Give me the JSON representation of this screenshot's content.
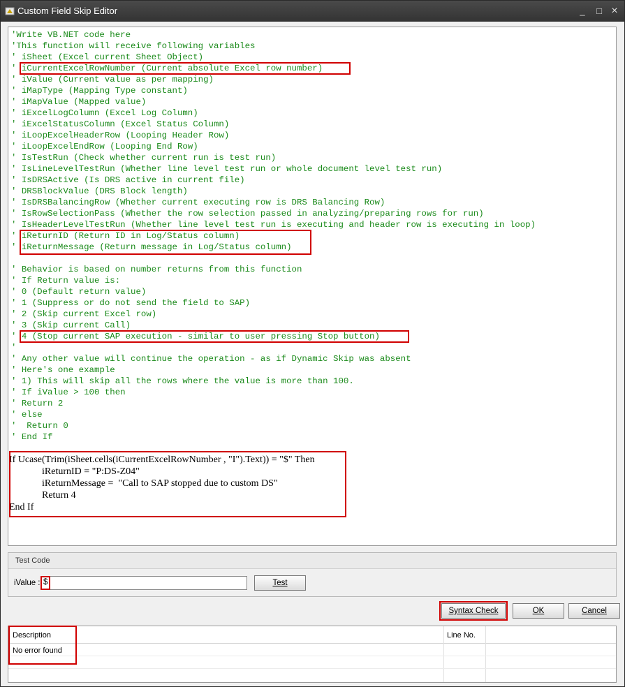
{
  "window": {
    "title": "Custom Field Skip Editor",
    "minimize_glyph": "_",
    "restore_glyph": "□",
    "close_glyph": "×"
  },
  "editor": {
    "comment_lines": [
      "'Write VB.NET code here",
      "'This function will receive following variables",
      "' iSheet (Excel current Sheet Object)",
      "' iCurrentExcelRowNumber (Current absolute Excel row number)",
      "' iValue (Current value as per mapping)",
      "' iMapType (Mapping Type constant)",
      "' iMapValue (Mapped value)",
      "' iExcelLogColumn (Excel Log Column)",
      "' iExcelStatusColumn (Excel Status Column)",
      "' iLoopExcelHeaderRow (Looping Header Row)",
      "' iLoopExcelEndRow (Looping End Row)",
      "' IsTestRun (Check whether current run is test run)",
      "' IsLineLevelTestRun (Whether line level test run or whole document level test run)",
      "' IsDRSActive (Is DRS active in current file)",
      "' DRSBlockValue (DRS Block length)",
      "' IsDRSBalancingRow (Whether current executing row is DRS Balancing Row)",
      "' IsRowSelectionPass (Whether the row selection passed in analyzing/preparing rows for run)",
      "' IsHeaderLevelTestRun (Whether line level test run is executing and header row is executing in loop)",
      "' iReturnID (Return ID in Log/Status column)",
      "' iReturnMessage (Return message in Log/Status column)",
      "",
      "' Behavior is based on number returns from this function",
      "' If Return value is:",
      "' 0 (Default return value)",
      "' 1 (Suppress or do not send the field to SAP)",
      "' 2 (Skip current Excel row)",
      "' 3 (Skip current Call)",
      "' 4 (Stop current SAP execution - similar to user pressing Stop button)",
      "'",
      "' Any other value will continue the operation - as if Dynamic Skip was absent",
      "' Here's one example",
      "' 1) This will skip all the rows where the value is more than 100.",
      "' If iValue > 100 then",
      "' Return 2",
      "' else",
      "'  Return 0",
      "' End If"
    ],
    "vb_lines": [
      "If Ucase(Trim(iSheet.cells(iCurrentExcelRowNumber , \"I\").Text)) = \"$\" Then",
      "iReturnID = \"P:DS-Z04\"",
      "iReturnMessage =  \"Call to SAP stopped due to custom DS\"",
      "Return 4",
      "End If"
    ]
  },
  "test_code": {
    "group_title": "Test Code",
    "ivalue_label": "iValue :",
    "ivalue_value": "$",
    "test_button": "Test"
  },
  "actions": {
    "syntax_check": "Syntax Check",
    "ok": "OK",
    "cancel": "Cancel"
  },
  "results": {
    "columns": [
      "Description",
      "Line No."
    ],
    "rows": [
      {
        "description": "No error found",
        "line": ""
      }
    ]
  },
  "colors": {
    "comment": "#1a8a1a",
    "highlight_box": "#d00000",
    "title_bar": "#3a3a3a"
  }
}
